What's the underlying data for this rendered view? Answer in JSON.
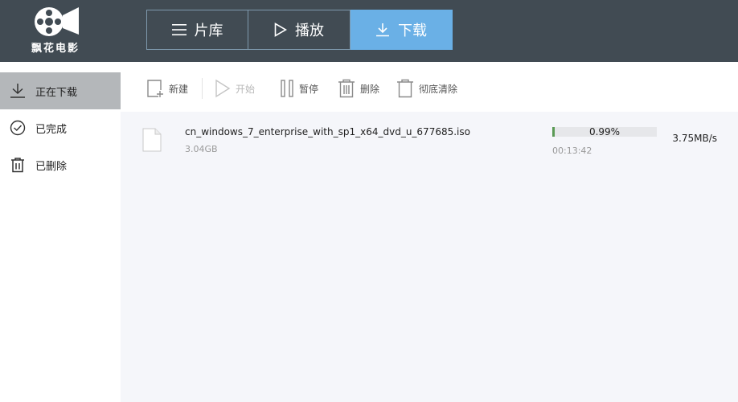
{
  "app": {
    "logo_text": "飘花电影"
  },
  "tabs": [
    {
      "label": "片库",
      "icon": "list-icon"
    },
    {
      "label": "播放",
      "icon": "play-icon"
    },
    {
      "label": "下载",
      "icon": "download-icon",
      "active": true
    }
  ],
  "sidebar": {
    "items": [
      {
        "label": "正在下载",
        "icon": "download-icon",
        "active": true
      },
      {
        "label": "已完成",
        "icon": "check-circle-icon"
      },
      {
        "label": "已删除",
        "icon": "trash-icon"
      }
    ]
  },
  "toolbar": {
    "new_label": "新建",
    "start_label": "开始",
    "pause_label": "暂停",
    "delete_label": "删除",
    "purge_label": "彻底清除"
  },
  "downloads": [
    {
      "filename": "cn_windows_7_enterprise_with_sp1_x64_dvd_u_677685.iso",
      "size": "3.04GB",
      "progress_percent": 0.99,
      "progress_text": "0.99%",
      "remaining_time": "00:13:42",
      "speed": "3.75MB/s"
    }
  ],
  "colors": {
    "titlebar": "#414b53",
    "tab_active": "#6ab0e6",
    "sidebar_active": "#b4b7ba",
    "progress": "#5a9a55"
  }
}
